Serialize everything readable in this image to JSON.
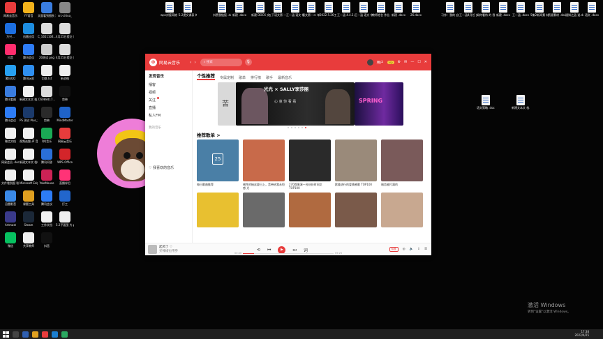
{
  "desktop": {
    "left_icons": [
      {
        "label": "网易云音乐",
        "color": "#e83c3c"
      },
      {
        "label": "YY语音",
        "color": "#f2b21b"
      },
      {
        "label": "文面看到图秋 我学",
        "color": "#3a7de0"
      },
      {
        "label": "src-china_",
        "color": "#888888"
      },
      {
        "label": "万兴...",
        "color": "#1d6fe0"
      },
      {
        "label": "迅雷应用",
        "color": "#1d8de0"
      },
      {
        "label": "C_1651104...",
        "color": "#dddddd"
      },
      {
        "label": "4月25日提交 课程记录...",
        "color": "#dddddd"
      },
      {
        "label": "抖音",
        "color": "#ff2d6d"
      },
      {
        "label": "腾讯会议",
        "color": "#2d7cf6"
      },
      {
        "label": "20测试 png",
        "color": "#cccccc"
      },
      {
        "label": "4月25日提交 课程记录...",
        "color": "#dddddd"
      },
      {
        "label": "腾讯QQ",
        "color": "#27a0f2"
      },
      {
        "label": "腾讯玩家",
        "color": "#2f8ff0"
      },
      {
        "label": "切换.txt",
        "color": "#eeeeee"
      },
      {
        "label": "新浪微",
        "color": "#f0f0f0"
      },
      {
        "label": "腾讯看图",
        "color": "#3a7de0"
      },
      {
        "label": "新建文本文 档.txt",
        "color": "#f0f0f0"
      },
      {
        "label": "C6088417...",
        "color": "#dddddd"
      },
      {
        "label": "剪映",
        "color": "#111111"
      },
      {
        "label": "腾讯会议",
        "color": "#2d7cf6"
      },
      {
        "label": "PS 测试 Plus_v9.23...",
        "color": "#1b3a6b"
      },
      {
        "label": "剪映",
        "color": "#2a2a2a"
      },
      {
        "label": "MindMaster",
        "color": "#1f63c9"
      },
      {
        "label": "微信文档",
        "color": "#f0f0f0"
      },
      {
        "label": "视频选题-声 音.docx",
        "color": "#f0f0f0"
      },
      {
        "label": "QQ音乐",
        "color": "#1aaa55"
      },
      {
        "label": "网易云音乐",
        "color": "#e83c3c"
      },
      {
        "label": "网易会员 .docx",
        "color": "#f0f0f0"
      },
      {
        "label": "新建文本文 档(2).txt",
        "color": "#f0f0f0"
      },
      {
        "label": "腾讯问答",
        "color": "#2a6fd8"
      },
      {
        "label": "WPS Office",
        "color": "#d3252a"
      },
      {
        "label": "文件看到图 秋 我学",
        "color": "#f0f0f0"
      },
      {
        "label": "Microsoft Edge",
        "color": "#f0f0f0"
      },
      {
        "label": "YoloMouse",
        "color": "#cc2255"
      },
      {
        "label": "直播伴侣",
        "color": "#ff3377"
      },
      {
        "label": "迅雷影音",
        "color": "#3a8ae8"
      },
      {
        "label": "课题工具",
        "color": "#e0a020"
      },
      {
        "label": "腾讯会议",
        "color": "#2d7cf6"
      },
      {
        "label": "打工",
        "color": "#2266cc"
      },
      {
        "label": "Artmast",
        "color": "#3a3a8a"
      },
      {
        "label": "Steam",
        "color": "#1b2838"
      },
      {
        "label": "工作文档",
        "color": "#f0f0f0"
      },
      {
        "label": "5.2平面图 片.png",
        "color": "#f0f0f0"
      },
      {
        "label": "微信",
        "color": "#07c160"
      },
      {
        "label": "共享教师",
        "color": "#f0f0f0"
      },
      {
        "label": "抖音",
        "color": "#111111"
      }
    ],
    "top_files": [
      "wps对接网络 子务.docx",
      "5.2提交课表 的说明.xlsx",
      "抖赞我链接 .docx",
      "新建 .docx",
      "新建 DOCX 文档 (2).docx",
      "五下语文第 一二单元...",
      "王一涵 语文 字词可能...",
      "语文第一二 单元字词...",
      "2022.5.26工 作完员.docx",
      "王一涵 4.4.2.docx",
      "王一涵 语文 字词可能...",
      "教师姓名 作业.xlsx",
      "新建 .docx",
      "26.docx",
      "习作：我的 自我的人...",
      "王一涵4月任 务.docx",
      "如何看待 的 我的...",
      "新建 .docx",
      "王一涵 .docx",
      "5集2新闻素 材.xlsx",
      "资源素材 .docx",
      "通知之函 说.docx",
      "语文 .docx"
    ],
    "right_files": [
      "语文策略 .docx",
      "新建文本文 档.txt"
    ],
    "watermark": {
      "line1": "激活 Windows",
      "line2": "转到\"设置\"以激活 Windows。"
    },
    "clock": {
      "time": "17:38",
      "date": "2022/4/25"
    }
  },
  "app": {
    "title": "网易云音乐",
    "search_placeholder": "搜索",
    "user_name": "用户",
    "vip": "vip",
    "sidebar": {
      "header": "发现音乐",
      "items": [
        "播客",
        "视频",
        "关注",
        "直播",
        "私人FM"
      ],
      "section_label": "我的音乐",
      "collection_label": "我喜欢的音乐"
    },
    "tabs": [
      "个性推荐",
      "专属定制",
      "歌单",
      "排行榜",
      "歌手",
      "最新音乐"
    ],
    "banner": {
      "main_title": "光光 × SALLY李莎丽",
      "main_sub": "心 意 你 看 看",
      "left_text": "苦",
      "right_text": "SPRING"
    },
    "section_title": "推荐歌单 >",
    "playlists": [
      {
        "caption": "每日歌曲推荐",
        "cover": "#4a7fa6"
      },
      {
        "caption": "感性的抽丝夏日上，音带给我永恒感 光",
        "cover": "#c86a4a"
      },
      {
        "caption": "270首像演一台处处时间文 TOP100",
        "cover": "#2a2a2a"
      },
      {
        "caption": "欧美流行的爱情感歌 TOP100",
        "cover": "#9a8a7a"
      },
      {
        "caption": "暗恋被打满的",
        "cover": "#7a5a5a"
      },
      {
        "caption": "",
        "cover": "#e8c030"
      },
      {
        "caption": "",
        "cover": "#6a6a6a"
      },
      {
        "caption": "",
        "cover": "#b06a40"
      },
      {
        "caption": "",
        "cover": "#7a5a4a"
      },
      {
        "caption": "",
        "cover": "#c8a890"
      }
    ],
    "player": {
      "song": "起风了",
      "artist": "买辣椒也用券",
      "time_start": "00:40",
      "time_end": "05:25",
      "progress": 0.12,
      "quality": "标准"
    }
  }
}
